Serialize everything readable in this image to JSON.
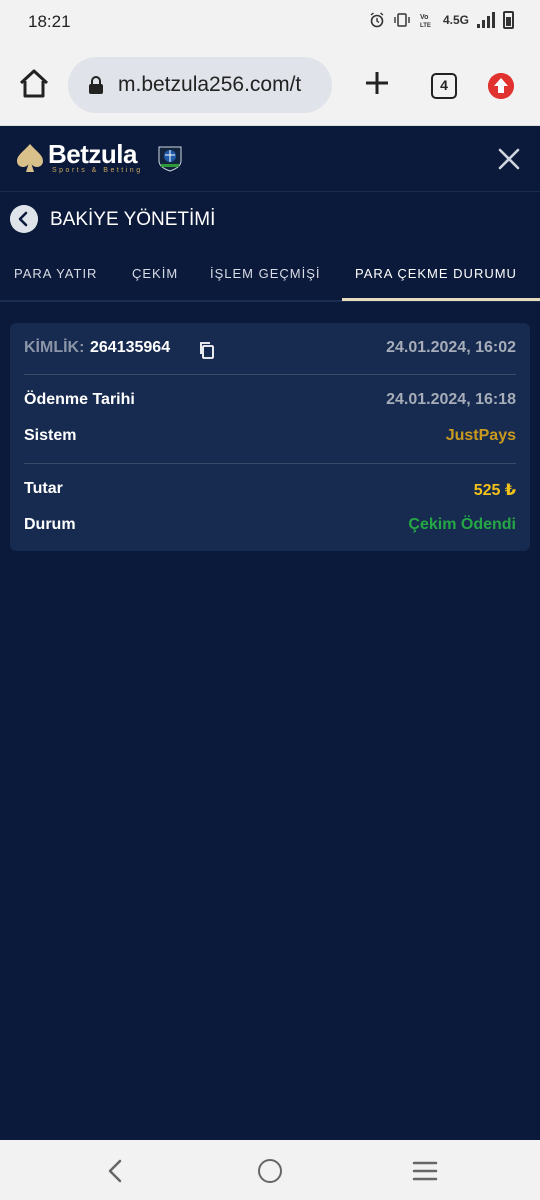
{
  "status_bar": {
    "time": "18:21",
    "network": "4.5G"
  },
  "browser": {
    "url": "m.betzula256.com/t",
    "tab_count": "4"
  },
  "app": {
    "brand_name": "Betzula",
    "brand_tagline": "Sports & Betting",
    "page_title": "BAKİYE YÖNETİMİ"
  },
  "tabs": [
    {
      "label": "PARA YATIR",
      "active": false
    },
    {
      "label": "ÇEKİM",
      "active": false
    },
    {
      "label": "İŞLEM GEÇMİŞİ",
      "active": false
    },
    {
      "label": "PARA ÇEKME DURUMU",
      "active": true
    }
  ],
  "transaction": {
    "id_label": "KİMLİK:",
    "id_value": "264135964",
    "created_at": "24.01.2024, 16:02",
    "payment_date_label": "Ödenme Tarihi",
    "payment_date_value": "24.01.2024, 16:18",
    "system_label": "Sistem",
    "system_value": "JustPays",
    "amount_label": "Tutar",
    "amount_value": "525 ₺",
    "status_label": "Durum",
    "status_value": "Çekim Ödendi"
  },
  "colors": {
    "background": "#0b1a3a",
    "card": "#172a4f",
    "accent_gold": "#c99a1d",
    "amount_yellow": "#f3c21a",
    "status_green": "#24a845",
    "tab_underline": "#e7dcbc"
  },
  "icons": {
    "home": "home-icon",
    "lock": "lock-icon",
    "plus": "plus-icon",
    "update": "update-arrow-icon",
    "close": "close-icon",
    "back": "chevron-left-icon",
    "copy": "copy-icon"
  }
}
